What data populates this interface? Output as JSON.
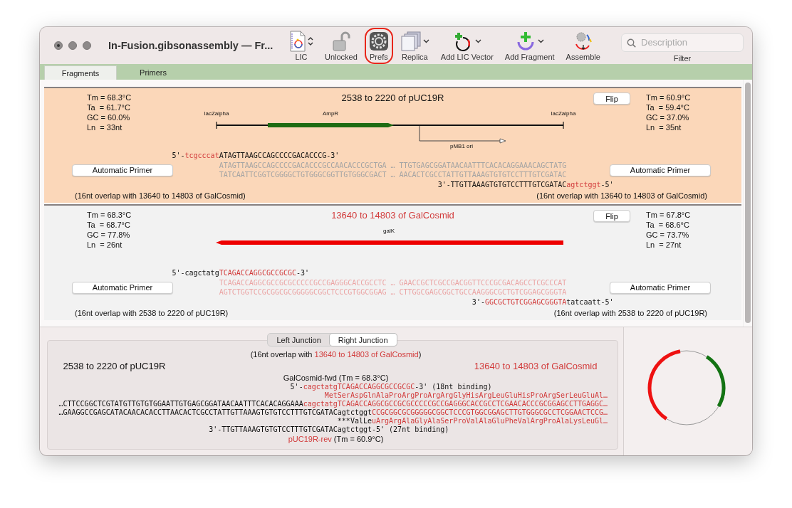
{
  "window": {
    "title": "In-Fusion.gibsonassembly — Fr..."
  },
  "toolbar": [
    {
      "label": "LIC",
      "kind": "document",
      "dropdown": true,
      "highlighted": false
    },
    {
      "label": "Unlocked",
      "kind": "lock",
      "dropdown": false,
      "highlighted": false
    },
    {
      "label": "Prefs",
      "kind": "gear",
      "dropdown": false,
      "highlighted": true
    },
    {
      "label": "Replica",
      "kind": "pages",
      "dropdown": true,
      "highlighted": false
    },
    {
      "label": "Add LIC Vector",
      "kind": "vector",
      "dropdown": true,
      "highlighted": false
    },
    {
      "label": "Add Fragment",
      "kind": "fragment",
      "dropdown": true,
      "highlighted": false
    },
    {
      "label": "Assemble",
      "kind": "assemble",
      "dropdown": false,
      "highlighted": false
    }
  ],
  "search": {
    "placeholder": "Description",
    "label": "Filter"
  },
  "tabs": [
    {
      "label": "Fragments",
      "selected": true
    },
    {
      "label": "Primers",
      "selected": false
    }
  ],
  "fragments": [
    {
      "kind": "vector",
      "selected": true,
      "title": "2538 to 2220 of pUC19R",
      "flip": "Flip",
      "stats_left": [
        "Tm = 68.3°C",
        "Ta  = 61.7°C",
        "GC = 60.0%",
        "Ln  = 33nt"
      ],
      "stats_right": [
        "Tm = 60.9°C",
        "Ta  = 59.4°C",
        "GC = 37.0%",
        "Ln  = 35nt"
      ],
      "features": [
        {
          "name": "lacZalpha",
          "kind": "start"
        },
        {
          "name": "AmpR",
          "kind": "arrow",
          "color": "#1d6b12"
        },
        {
          "name": "pMB1 ori",
          "kind": "branch"
        },
        {
          "name": "lacZalpha",
          "kind": "end"
        }
      ],
      "primer_fwd": [
        {
          "text": "5'-",
          "highlighted": false
        },
        {
          "text": "tcgcccat",
          "highlighted": true
        },
        {
          "text": "ATAGTTAAGCCAGCCCCGACACCCG-3'",
          "highlighted": false
        }
      ],
      "strand_top": "ATAGTTAAGCCAGCCCCGACACCCGCCAACACCCGCTGA … TTGTGAGCGGATAACAATTTCACACAGGAAACAGCTATG",
      "strand_bottom": "TATCAATTCGGTCGGGGCTGTGGGCGGTTGTGGGCGACT … AACACTCGCCTATTGTTAAAGTGTGTCCTTTGTCGATAC",
      "primer_rev": [
        {
          "text": "3'-TTGTTAAAGTGTGTCCTTTGTCGATAC",
          "highlighted": false
        },
        {
          "text": "agtctggt",
          "highlighted": true
        },
        {
          "text": "-5'",
          "highlighted": false
        }
      ],
      "auto_buttons": [
        "Automatic Primer",
        "Automatic Primer"
      ],
      "overlap_left": "(16nt overlap with 13640 to 14803 of GalCosmid)",
      "overlap_right": "(16nt overlap with 13640 to 14803 of GalCosmid)"
    },
    {
      "kind": "insert",
      "selected": false,
      "title": "13640 to 14803 of GalCosmid",
      "flip": "Flip",
      "stats_left": [
        "Tm = 68.3°C",
        "Ta  = 68.7°C",
        "GC = 77.8%",
        "Ln  = 26nt"
      ],
      "stats_right": [
        "Tm = 67.8°C",
        "Ta  = 68.6°C",
        "GC = 73.7%",
        "Ln  = 27nt"
      ],
      "features": [
        {
          "name": "galK",
          "kind": "arrow_left",
          "color": "#ee0000"
        }
      ],
      "primer_fwd": [
        {
          "text": "5'-cagctatg",
          "highlighted": false
        },
        {
          "text": "TCAGACCAGGCGCCGCGC",
          "highlighted": true
        },
        {
          "text": "-3'",
          "highlighted": false
        }
      ],
      "strand_top": "TCAGACCAGGCGCCGCGCCCCCGCCGAGGGCACCGCCTC … GAACCGCTCGCCGACGGTTCCCGCGACAGCCTCGCCCAT",
      "strand_bottom": "AGTCTGGTCCGCGGCGCGGGGGCGGCTCCCGTGGCGGAG … CTTGGCGAGCGGCTGCCAAGGGCGCTGTCGGAGCGGGTA",
      "primer_rev": [
        {
          "text": "3'-",
          "highlighted": false
        },
        {
          "text": "GGCGCTGTCGGAGCGGGTA",
          "highlighted": true
        },
        {
          "text": "tatcaatt-5'",
          "highlighted": false
        }
      ],
      "auto_buttons": [
        "Automatic Primer",
        "Automatic Primer"
      ],
      "overlap_left": "(16nt overlap with 2538 to 2220 of pUC19R)",
      "overlap_right": "(16nt overlap with 2538 to 2220 of pUC19R)"
    }
  ],
  "junction": {
    "tabs": [
      {
        "label": "Left Junction",
        "selected": false
      },
      {
        "label": "Right Junction",
        "selected": true
      }
    ],
    "overlap": [
      {
        "text": "(16nt overlap with ",
        "highlighted": false
      },
      {
        "text": "13640 to 14803 of GalCosmid",
        "highlighted": true
      },
      {
        "text": ")",
        "highlighted": false
      }
    ],
    "left_title": {
      "text": "2538 to 2220 of pUC19R",
      "highlighted": false
    },
    "right_title": {
      "text": "13640 to 14803 of GalCosmid",
      "highlighted": true
    },
    "fwd_primer_name": "GalCosmid-fwd (Tm = 68.3°C)",
    "lines": [
      {
        "segments": [
          {
            "text": "5'-",
            "highlighted": false
          },
          {
            "text": "cagctatgTCAGACCAGGCGCCGCGC",
            "highlighted": true
          },
          {
            "text": "-3' (18nt binding)",
            "highlighted": false
          }
        ]
      },
      {
        "segments": [
          {
            "text": "MetSerAspGlnAlaProArgProArgArgGlyHisArgLeuGluHisProArgSerLeuGluAl…",
            "highlighted": true
          }
        ]
      },
      {
        "segments": [
          {
            "text": "…CTTCCGGCTCGTATGTTGTGTGGAATTGTGAGCGGATAACAATTTCACACAGGAAA",
            "highlighted": false
          },
          {
            "text": "cagctatgTCAGACCAGGCGCCGCGCCCCCGCCGAGGGCACCGCCTCGAACACCCGCGGAGCCTTGAGGC…",
            "highlighted": true
          }
        ]
      },
      {
        "segments": [
          {
            "text": "…GAAGGCCGAGCATACAACACACCTTAACACTCGCCTATTGTTAAAGTGTGTCCTTTGTCGATACagtctggt",
            "highlighted": false
          },
          {
            "text": "CCGCGGCGCGGGGGCGGCTCCCGTGGCGGAGCTTGTGGGCGCCTCGGAACTCCG…",
            "highlighted": true
          }
        ]
      },
      {
        "segments": [
          {
            "text": "***ValLe",
            "highlighted": false
          },
          {
            "text": "uArgArgAlaGlyAlaSerProValAlaGluPheValArgProAlaLysLeuGl…",
            "highlighted": true
          }
        ]
      },
      {
        "segments": [
          {
            "text": "3'-TTGTTAAAGTGTGTCCTTTGTCGATACagtctggt-5' (27nt binding)",
            "highlighted": false
          }
        ]
      }
    ],
    "rev_primer_name": [
      {
        "text": "pUC19R-rev",
        "highlighted": true
      },
      {
        "text": " (Tm = 60.9°C)",
        "highlighted": false
      }
    ]
  }
}
